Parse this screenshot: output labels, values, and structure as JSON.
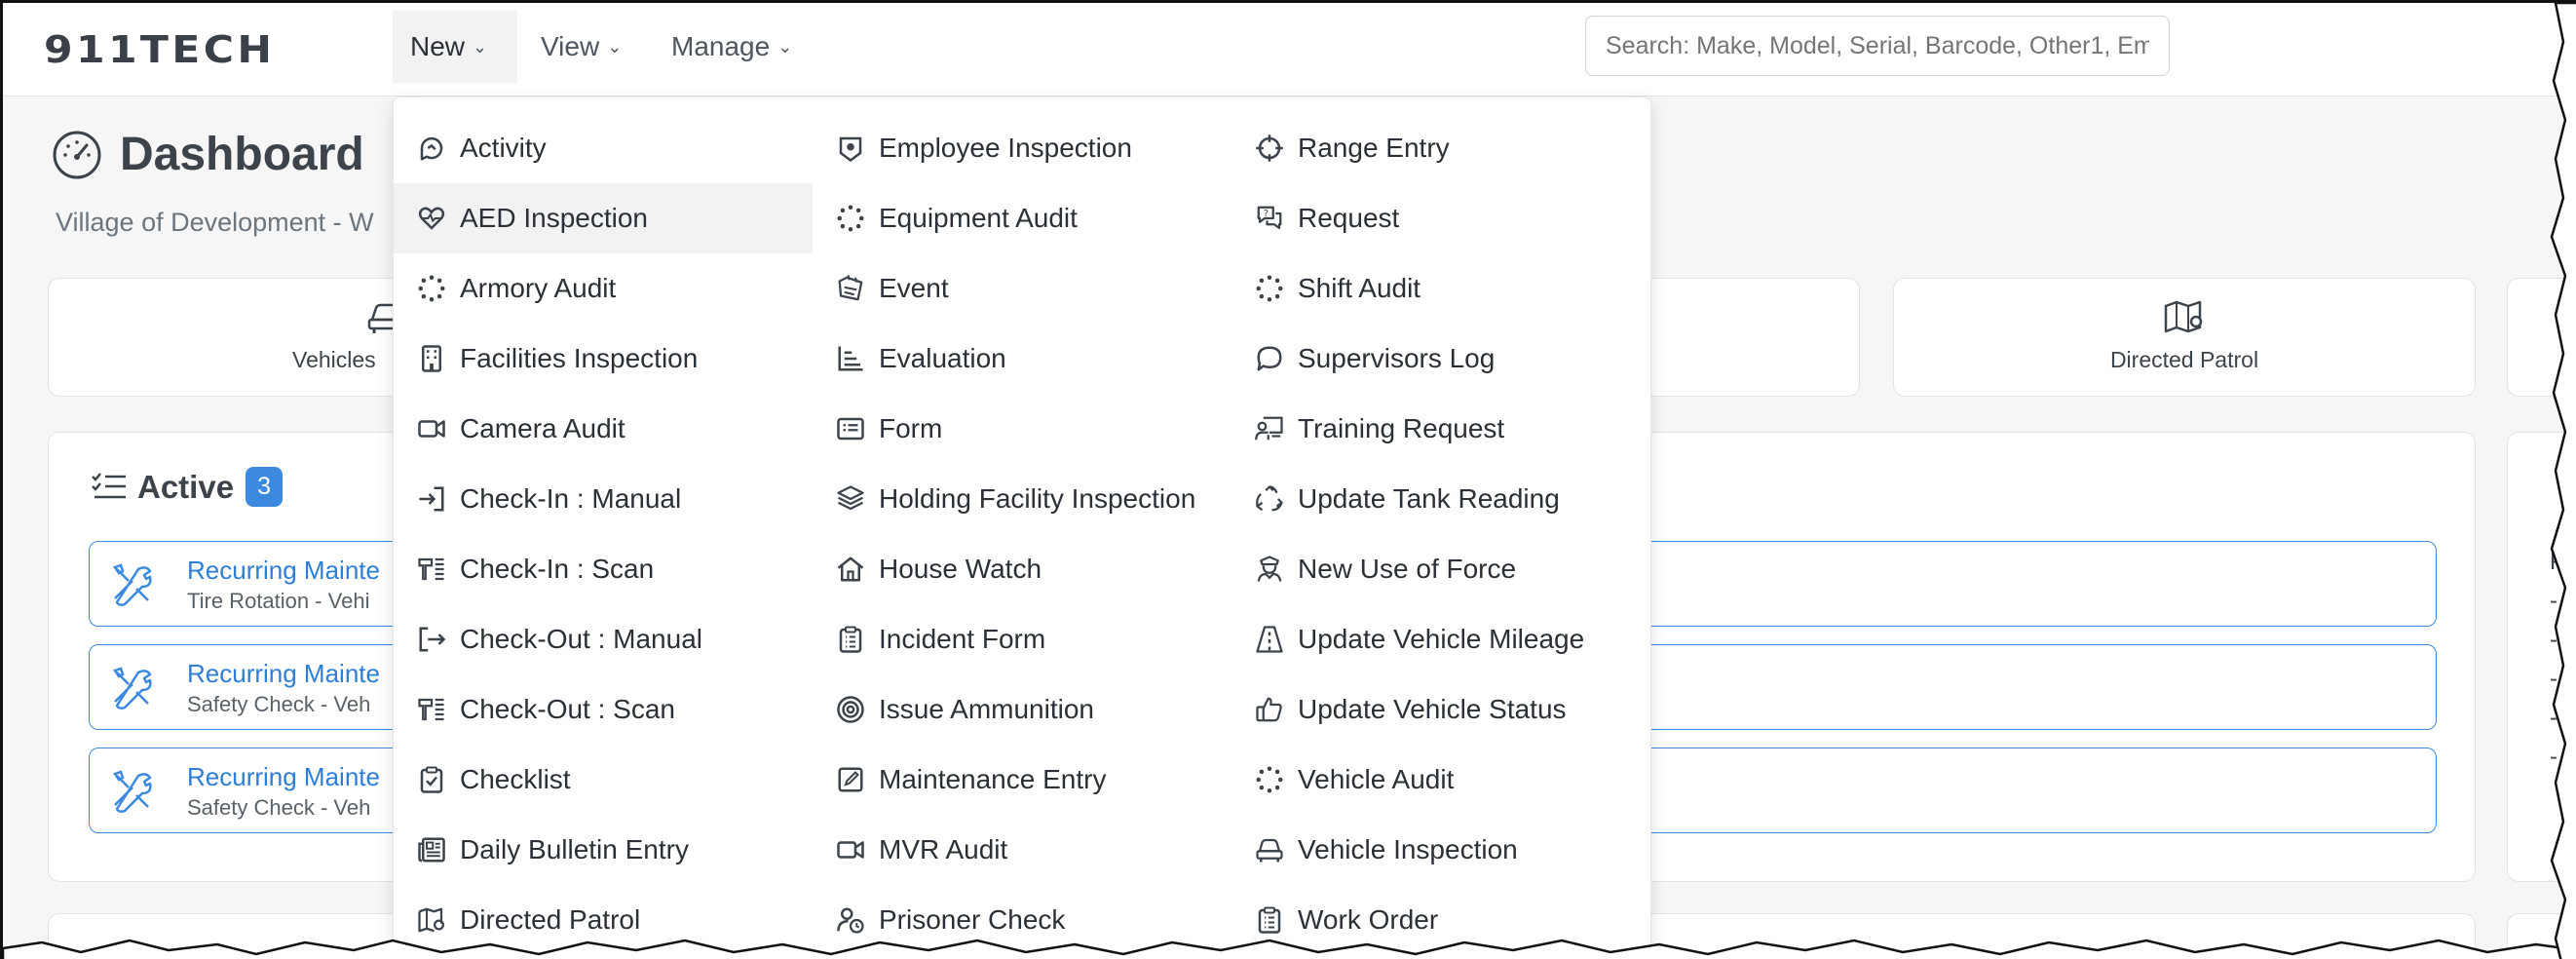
{
  "header": {
    "logo": "911TECH",
    "nav": [
      "New",
      "View",
      "Manage"
    ],
    "search_placeholder": "Search: Make, Model, Serial, Barcode, Other1, Em"
  },
  "page": {
    "title": "Dashboard",
    "org": "Village of Development - W"
  },
  "tiles": [
    {
      "label": "Vehicles",
      "icon": "car-icon"
    },
    {
      "label": "Directed Patrol",
      "icon": "map-pin-icon"
    }
  ],
  "active": {
    "title": "Active",
    "count": "3",
    "tasks": [
      {
        "title": "Recurring Mainte",
        "sub": "Tire Rotation - Vehi"
      },
      {
        "title": "Recurring Mainte",
        "sub": "Safety Check - Veh"
      },
      {
        "title": "Recurring Mainte",
        "sub": "Safety Check - Veh"
      }
    ]
  },
  "right_card": {
    "items": [
      "P",
      "-",
      "-",
      "-",
      "-",
      "-"
    ]
  },
  "menu": {
    "col1": [
      {
        "label": "Activity",
        "icon": "activity-icon"
      },
      {
        "label": "AED Inspection",
        "icon": "heart-pulse-icon"
      },
      {
        "label": "Armory Audit",
        "icon": "loader-icon"
      },
      {
        "label": "Facilities Inspection",
        "icon": "building-icon"
      },
      {
        "label": "Camera Audit",
        "icon": "video-camera-icon"
      },
      {
        "label": "Check-In : Manual",
        "icon": "sign-in-icon"
      },
      {
        "label": "Check-In : Scan",
        "icon": "barcode-scanner-icon"
      },
      {
        "label": "Check-Out : Manual",
        "icon": "sign-out-icon"
      },
      {
        "label": "Check-Out : Scan",
        "icon": "barcode-scanner-icon"
      },
      {
        "label": "Checklist",
        "icon": "clipboard-check-icon"
      },
      {
        "label": "Daily Bulletin Entry",
        "icon": "newspaper-icon"
      },
      {
        "label": "Directed Patrol",
        "icon": "map-pin-icon"
      }
    ],
    "col2": [
      {
        "label": "Employee Inspection",
        "icon": "id-badge-icon"
      },
      {
        "label": "Equipment Audit",
        "icon": "loader-icon"
      },
      {
        "label": "Event",
        "icon": "calendar-icon"
      },
      {
        "label": "Evaluation",
        "icon": "chart-icon"
      },
      {
        "label": "Form",
        "icon": "form-icon"
      },
      {
        "label": "Holding Facility Inspection",
        "icon": "layers-icon"
      },
      {
        "label": "House Watch",
        "icon": "house-icon"
      },
      {
        "label": "Incident Form",
        "icon": "clipboard-list-icon"
      },
      {
        "label": "Issue Ammunition",
        "icon": "target-icon"
      },
      {
        "label": "Maintenance Entry",
        "icon": "edit-icon"
      },
      {
        "label": "MVR Audit",
        "icon": "video-camera-icon"
      },
      {
        "label": "Prisoner Check",
        "icon": "user-clock-icon"
      }
    ],
    "col3": [
      {
        "label": "Range Entry",
        "icon": "crosshair-icon"
      },
      {
        "label": "Request",
        "icon": "chat-question-icon"
      },
      {
        "label": "Shift Audit",
        "icon": "loader-icon"
      },
      {
        "label": "Supervisors Log",
        "icon": "chat-bubble-icon"
      },
      {
        "label": "Training Request",
        "icon": "presentation-icon"
      },
      {
        "label": "Update Tank Reading",
        "icon": "recycle-icon"
      },
      {
        "label": "New Use of Force",
        "icon": "officer-icon"
      },
      {
        "label": "Update Vehicle Mileage",
        "icon": "road-icon"
      },
      {
        "label": "Update Vehicle Status",
        "icon": "thumbs-up-icon"
      },
      {
        "label": "Vehicle Audit",
        "icon": "loader-icon"
      },
      {
        "label": "Vehicle Inspection",
        "icon": "car-icon"
      },
      {
        "label": "Work Order",
        "icon": "clipboard-list-icon"
      }
    ]
  }
}
